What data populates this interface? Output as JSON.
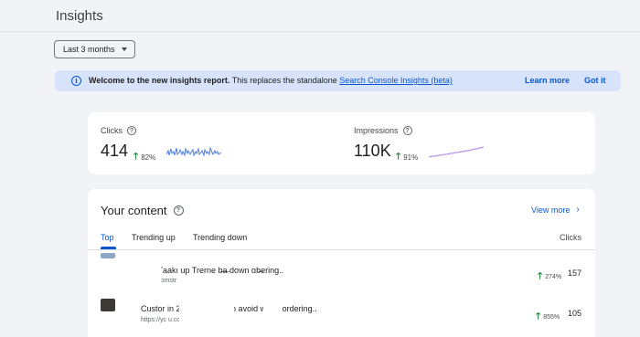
{
  "page": {
    "title": "Insights"
  },
  "filter": {
    "date_range": "Last 3 months"
  },
  "banner": {
    "bold": "Welcome to the new insights report.",
    "text": " This replaces the standalone ",
    "link": "Search Console Insights (beta)",
    "learn_more": "Learn more",
    "got_it": "Got it",
    "info_icon": "i"
  },
  "metrics": {
    "clicks": {
      "label": "Clicks",
      "value": "414",
      "delta": "82%",
      "spark_color": "#4b7fe3"
    },
    "impressions": {
      "label": "Impressions",
      "value": "110K",
      "delta": "91%",
      "spark_color": "#a77be0"
    }
  },
  "content": {
    "title": "Your content",
    "view_more": "View more",
    "tabs": [
      "Top",
      "Trending up",
      "Trending down"
    ],
    "active_tab": "Top",
    "column_header": "Clicks",
    "rows": [
      {
        "title": "ʼaakı up      Trerne b̶a̶ down     ɑb̶ering..",
        "url": "ɔmstr",
        "delta": "274%",
        "clicks": "157"
      },
      {
        "title": "Custor       in 2025        nistakes to avoid when ordering..",
        "url": "https://yc         u.com.au      nets-in-2025/",
        "delta": "855%",
        "clicks": "105"
      }
    ]
  },
  "help_icon": "?",
  "arrow_up": "🡑",
  "chevron": "›"
}
